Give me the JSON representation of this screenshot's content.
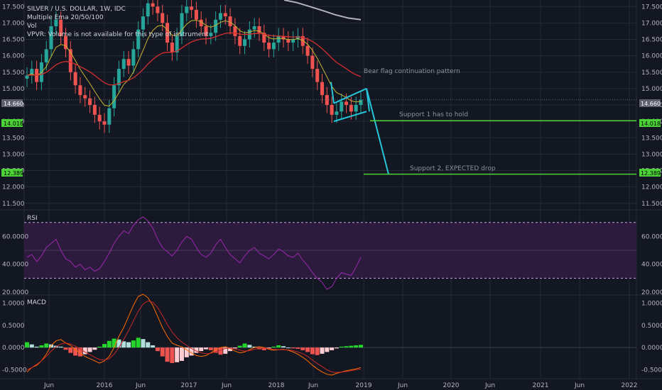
{
  "header": {
    "title": "SILVER / U.S. DOLLAR, 1W, IDC",
    "indicator1": "Multiple Ema 20/50/100",
    "indicator2": "Vol",
    "indicator3": "VPVR: Volume is not available for this type of instrument"
  },
  "colors": {
    "background": "#131722",
    "grid": "#242a38",
    "up_candle": "#26a69a",
    "down_candle": "#ef5350",
    "ema20": "#c8b531",
    "ema50": "#d32f2f",
    "ema100": "#b0b3bb",
    "drawing": "#26c6da",
    "support": "#4cd137",
    "rsi": "#9c27b0",
    "macd_line": "#ff6d00",
    "signal_line": "#c62828"
  },
  "annotations": {
    "bear_flag": "Bear flag continuation pattern",
    "support1": "Support 1 has to hold",
    "support2": "Support 2, EXPECTED drop"
  },
  "price_tags": {
    "current": "14.660",
    "support1": "14.018",
    "support2": "12.389"
  },
  "panels": {
    "rsi_label": "RSI",
    "macd_label": "MACD"
  },
  "chart_data": [
    {
      "type": "candlestick",
      "title": "SILVER / U.S. DOLLAR, 1W, IDC",
      "x_ticks": [
        "Jun",
        "2016",
        "Jun",
        "2017",
        "Jun",
        "2018",
        "Jun",
        "2019",
        "Jun",
        "2020",
        "Jun",
        "2021",
        "Jun",
        "2022"
      ],
      "y_ticks": [
        "17.500",
        "17.000",
        "16.500",
        "16.000",
        "15.500",
        "15.000",
        "14.500",
        "14.000",
        "13.500",
        "13.000",
        "12.500",
        "12.000",
        "11.500"
      ],
      "ylim": [
        11.3,
        17.7
      ],
      "close_series": [
        15.4,
        15.6,
        15.2,
        15.8,
        16.2,
        16.9,
        17.1,
        16.6,
        16.2,
        15.5,
        15.1,
        14.8,
        14.7,
        14.5,
        14.2,
        14.0,
        13.9,
        14.4,
        15.1,
        15.6,
        15.9,
        15.7,
        16.2,
        16.8,
        17.2,
        17.6,
        17.5,
        17.3,
        17.0,
        16.4,
        16.1,
        16.6,
        17.3,
        17.5,
        17.4,
        17.1,
        16.9,
        16.6,
        16.7,
        17.1,
        17.3,
        17.2,
        16.9,
        16.6,
        16.3,
        16.5,
        16.8,
        16.9,
        16.7,
        16.4,
        16.2,
        16.4,
        16.6,
        16.5,
        16.4,
        16.5,
        16.6,
        16.3,
        16.0,
        15.6,
        15.2,
        14.8,
        14.5,
        14.2,
        14.3,
        14.6,
        14.5,
        14.3,
        14.5,
        14.66
      ],
      "ema_20_50_100": {
        "ema20_last": 14.7,
        "ema50_last": 15.55,
        "ema100_last": 17.1
      },
      "bear_flag": {
        "channel_top": [
          14.55,
          15.0
        ],
        "channel_bottom": [
          14.0,
          14.3
        ],
        "target_drop_to": 12.389
      },
      "support_levels": [
        14.018,
        12.389
      ],
      "current_price": 14.66
    },
    {
      "type": "line",
      "title": "RSI",
      "y_ticks": [
        "60.0000",
        "40.0000",
        "20.0000"
      ],
      "ylim": [
        18,
        78
      ],
      "bands": [
        70,
        30
      ],
      "values": [
        45,
        47,
        42,
        46,
        52,
        55,
        58,
        50,
        44,
        42,
        38,
        40,
        36,
        38,
        35,
        37,
        42,
        48,
        55,
        60,
        64,
        62,
        68,
        72,
        74,
        71,
        66,
        58,
        52,
        49,
        46,
        50,
        56,
        60,
        58,
        52,
        47,
        45,
        48,
        54,
        58,
        52,
        47,
        44,
        41,
        46,
        50,
        52,
        48,
        46,
        44,
        47,
        51,
        49,
        46,
        45,
        48,
        43,
        39,
        34,
        30,
        27,
        22,
        24,
        30,
        34,
        33,
        32,
        38,
        45
      ]
    },
    {
      "type": "bar",
      "title": "MACD",
      "y_ticks": [
        "1.0000",
        "0.5000",
        "0.0000",
        "-0.5000"
      ],
      "ylim": [
        -0.7,
        1.15
      ],
      "histogram": [
        0.12,
        0.07,
        0.02,
        0.05,
        0.09,
        0.07,
        0.04,
        0.02,
        -0.05,
        -0.12,
        -0.18,
        -0.2,
        -0.15,
        -0.1,
        -0.05,
        0.02,
        0.08,
        0.15,
        0.2,
        0.18,
        0.14,
        0.12,
        0.16,
        0.22,
        0.19,
        0.12,
        0.05,
        -0.08,
        -0.2,
        -0.32,
        -0.35,
        -0.33,
        -0.3,
        -0.22,
        -0.18,
        -0.12,
        -0.08,
        -0.04,
        -0.06,
        -0.12,
        -0.16,
        -0.14,
        -0.08,
        -0.02,
        0.04,
        0.09,
        0.06,
        0.02,
        -0.04,
        -0.06,
        -0.03,
        0.02,
        0.05,
        0.03,
        0.0,
        -0.02,
        -0.03,
        -0.06,
        -0.1,
        -0.15,
        -0.17,
        -0.14,
        -0.1,
        -0.06,
        -0.02,
        0.02,
        0.03,
        0.04,
        0.05,
        0.06
      ],
      "macd_line": [
        -0.55,
        -0.45,
        -0.4,
        -0.3,
        -0.15,
        0.05,
        0.15,
        0.18,
        0.1,
        0.05,
        -0.05,
        -0.12,
        -0.2,
        -0.25,
        -0.3,
        -0.35,
        -0.3,
        -0.2,
        0.0,
        0.25,
        0.45,
        0.7,
        0.95,
        1.15,
        1.2,
        1.12,
        0.95,
        0.7,
        0.45,
        0.25,
        0.1,
        0.05,
        0.02,
        -0.05,
        -0.12,
        -0.18,
        -0.2,
        -0.18,
        -0.12,
        -0.05,
        0.0,
        0.02,
        -0.02,
        -0.08,
        -0.12,
        -0.1,
        -0.05,
        0.0,
        0.02,
        0.0,
        -0.04,
        -0.06,
        -0.05,
        -0.04,
        -0.06,
        -0.1,
        -0.15,
        -0.22,
        -0.3,
        -0.4,
        -0.48,
        -0.55,
        -0.6,
        -0.62,
        -0.58,
        -0.55,
        -0.52,
        -0.5,
        -0.48,
        -0.45
      ],
      "signal_line": [
        -0.5,
        -0.45,
        -0.38,
        -0.3,
        -0.2,
        -0.08,
        0.02,
        0.08,
        0.1,
        0.08,
        0.03,
        -0.03,
        -0.1,
        -0.16,
        -0.22,
        -0.27,
        -0.28,
        -0.25,
        -0.15,
        0.0,
        0.18,
        0.38,
        0.6,
        0.82,
        0.98,
        1.05,
        1.02,
        0.9,
        0.72,
        0.52,
        0.35,
        0.22,
        0.12,
        0.05,
        -0.02,
        -0.08,
        -0.12,
        -0.14,
        -0.13,
        -0.1,
        -0.06,
        -0.02,
        -0.01,
        -0.03,
        -0.06,
        -0.08,
        -0.07,
        -0.04,
        -0.02,
        -0.01,
        -0.02,
        -0.04,
        -0.05,
        -0.05,
        -0.05,
        -0.07,
        -0.1,
        -0.14,
        -0.2,
        -0.28,
        -0.36,
        -0.43,
        -0.5,
        -0.55,
        -0.56,
        -0.55,
        -0.54,
        -0.52,
        -0.5,
        -0.48
      ]
    }
  ]
}
